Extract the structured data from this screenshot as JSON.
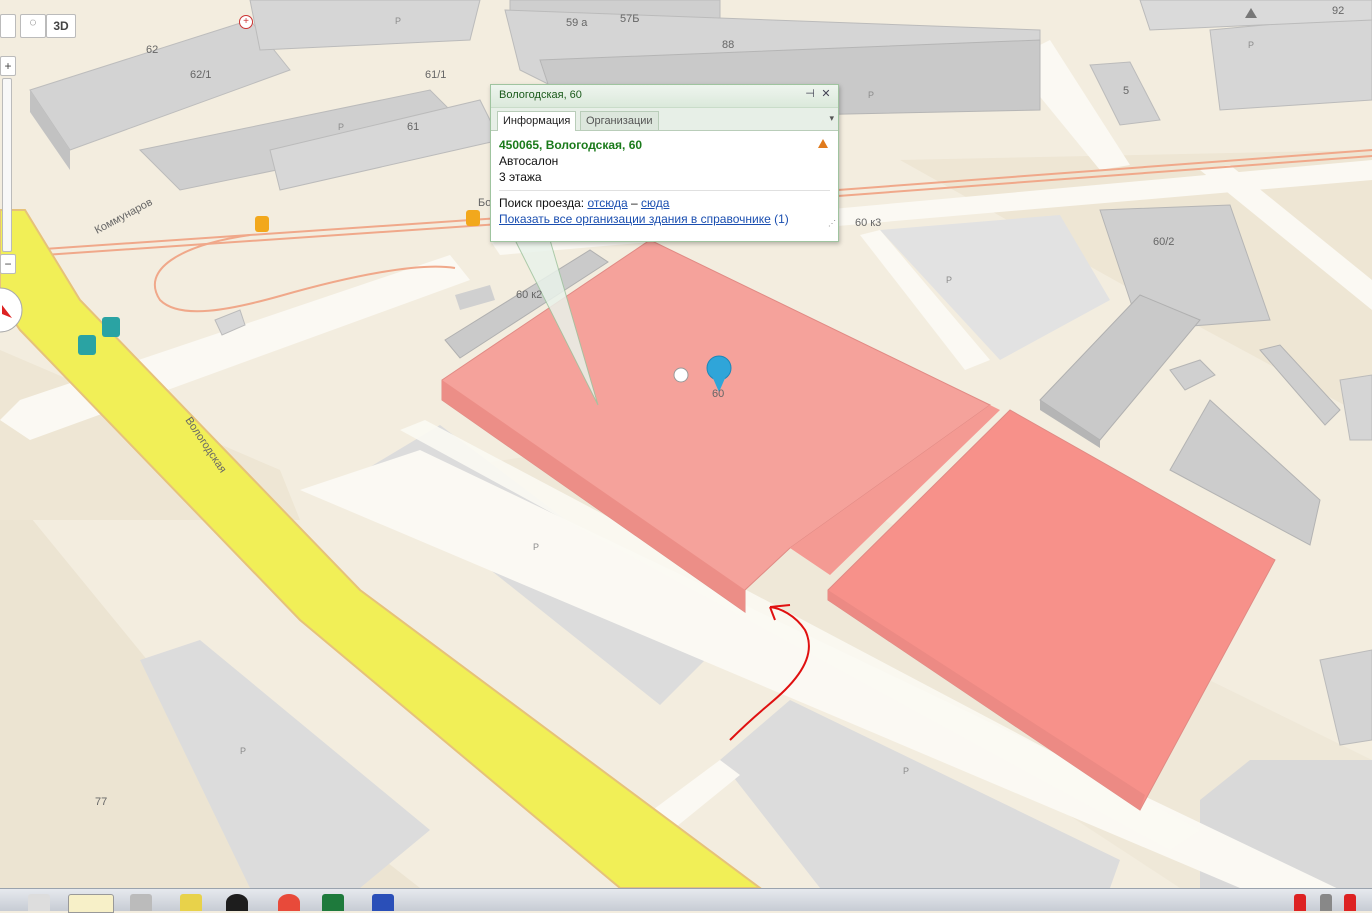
{
  "map": {
    "street_main": "Вологодская",
    "street_side": "Коммунаров",
    "street_side2": "Бол",
    "building_labels": [
      "62",
      "62/1",
      "61/1",
      "61",
      "59 а",
      "57Б",
      "88",
      "5",
      "92",
      "60 к3",
      "60/2",
      "60 к2",
      "77"
    ],
    "parking_label": "P",
    "marker_label": "60"
  },
  "popup": {
    "title": "Вологодская, 60",
    "tabs": [
      "Информация",
      "Организации"
    ],
    "address": "450065, Вологодская, 60",
    "category": "Автосалон",
    "floors": "3 этажа",
    "route_prefix": "Поиск проезда:",
    "route_from": "отсюда",
    "route_dash": "–",
    "route_to": "сюда",
    "all_orgs_link": "Показать все организации здания в справочнике",
    "all_orgs_count": "(1)",
    "pin_icon": "pin-icon",
    "close_icon": "close-icon"
  },
  "controls": {
    "mode_3d": "3D",
    "zoom_in": "+",
    "zoom_out": "−"
  },
  "colors": {
    "road_main": "#f1ef57",
    "building_highlight": "#f7918a",
    "building_gray": "#c8c8c8",
    "popup_border": "#9fc49f",
    "arrow": "#e01010",
    "tram": "#f2a81c",
    "bus": "#2aa3a3"
  }
}
